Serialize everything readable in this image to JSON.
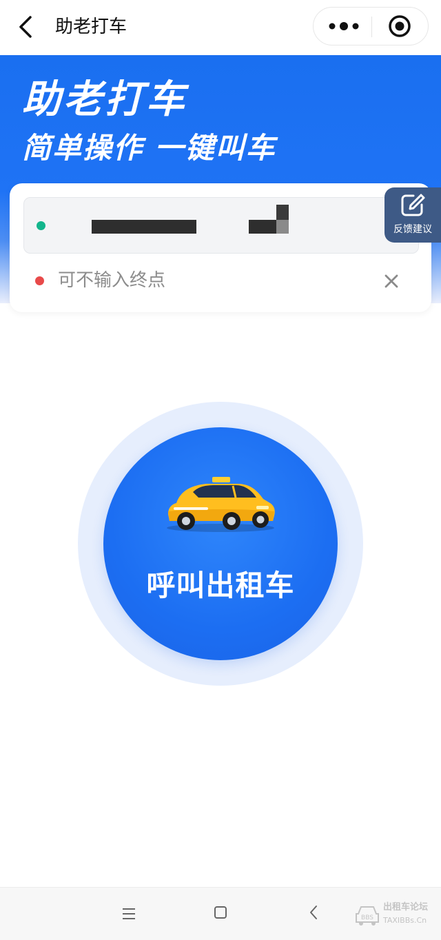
{
  "nav": {
    "title": "助老打车",
    "icons": [
      "chevron-left-icon",
      "more-dots-icon",
      "target-circle-icon"
    ]
  },
  "banner": {
    "title": "助老打车",
    "subtitle": "简单操作 一键叫车",
    "background_color": "#1f73f5"
  },
  "route": {
    "start_value_masked": true,
    "end_placeholder": "可不输入终点",
    "start_dot_color": "#13b58c",
    "end_dot_color": "#e84a4a"
  },
  "feedback": {
    "label": "反馈建议",
    "icon": "edit-icon"
  },
  "call": {
    "label": "呼叫出租车",
    "icon": "taxi-icon",
    "accent_color": "#1c6ef2"
  },
  "system_nav": {
    "icons": [
      "menu-icon",
      "home-square-icon",
      "back-arrow-icon"
    ]
  },
  "watermark": {
    "cn": "出租车论坛",
    "en": "TAXIBBs.Cn",
    "badge": "BBS"
  }
}
